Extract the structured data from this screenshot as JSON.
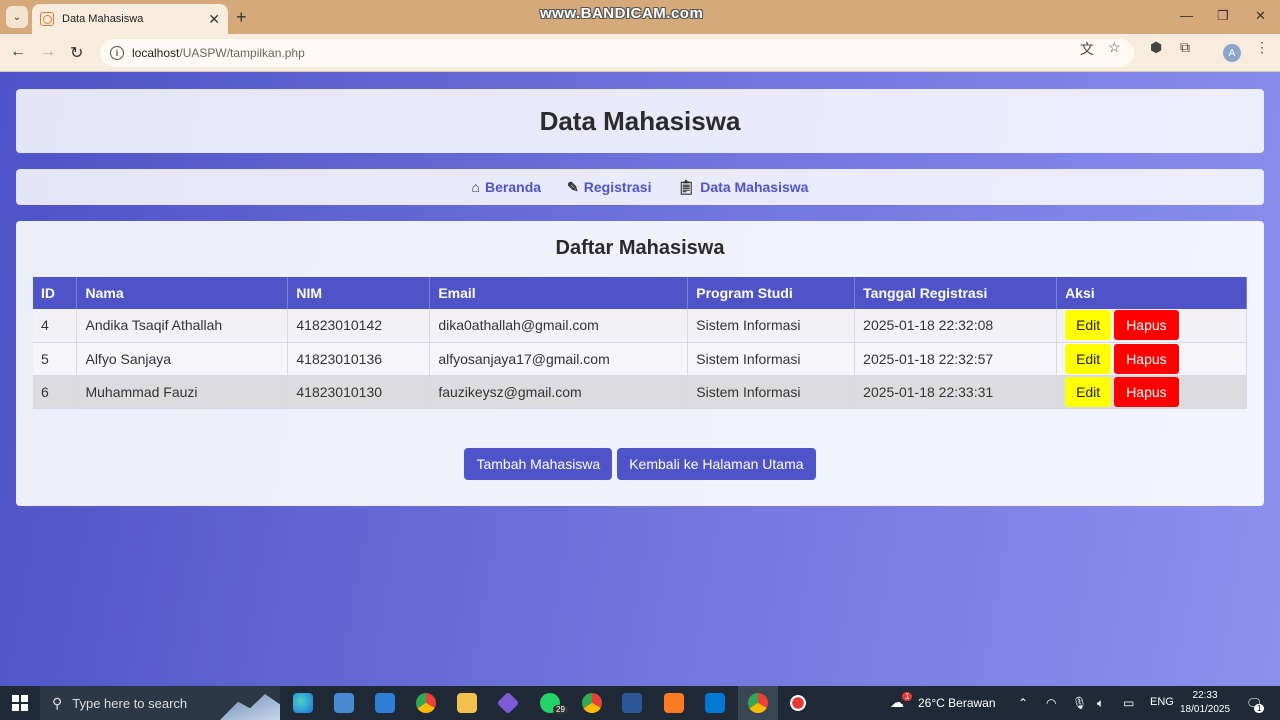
{
  "browser": {
    "tab_title": "Data Mahasiswa",
    "url_host": "localhost",
    "url_path": "/UASPW/tampilkan.php",
    "watermark": "www.BANDICAM.com",
    "profile_initial": "A"
  },
  "page": {
    "header_title": "Data Mahasiswa",
    "nav": [
      {
        "label": "Beranda",
        "icon": "home-icon"
      },
      {
        "label": "Registrasi",
        "icon": "edit-note-icon"
      },
      {
        "label": "Data Mahasiswa",
        "icon": "clipboard-icon"
      }
    ],
    "section_title": "Daftar Mahasiswa",
    "table": {
      "headers": [
        "ID",
        "Nama",
        "NIM",
        "Email",
        "Program Studi",
        "Tanggal Registrasi",
        "Aksi"
      ],
      "rows": [
        {
          "id": "4",
          "nama": "Andika Tsaqif Athallah",
          "nim": "41823010142",
          "email": "dika0athallah@gmail.com",
          "prodi": "Sistem Informasi",
          "tanggal": "2025-01-18 22:32:08"
        },
        {
          "id": "5",
          "nama": "Alfyo Sanjaya",
          "nim": "41823010136",
          "email": "alfyosanjaya17@gmail.com",
          "prodi": "Sistem Informasi",
          "tanggal": "2025-01-18 22:32:57"
        },
        {
          "id": "6",
          "nama": "Muhammad Fauzi",
          "nim": "41823010130",
          "email": "fauzikeysz@gmail.com",
          "prodi": "Sistem Informasi",
          "tanggal": "2025-01-18 22:33:31"
        }
      ],
      "edit_label": "Edit",
      "delete_label": "Hapus"
    },
    "add_button": "Tambah Mahasiswa",
    "back_button": "Kembali ke Halaman Utama"
  },
  "taskbar": {
    "search_placeholder": "Type here to search",
    "whatsapp_badge": "29",
    "weather": "26°C  Berawan",
    "weather_badge": "1",
    "language": "ENG",
    "time": "22:33",
    "date": "18/01/2025",
    "notification_badge": "1"
  },
  "colors": {
    "primary": "#4e54c8",
    "edit": "#ffff00",
    "delete": "#ff0000"
  }
}
